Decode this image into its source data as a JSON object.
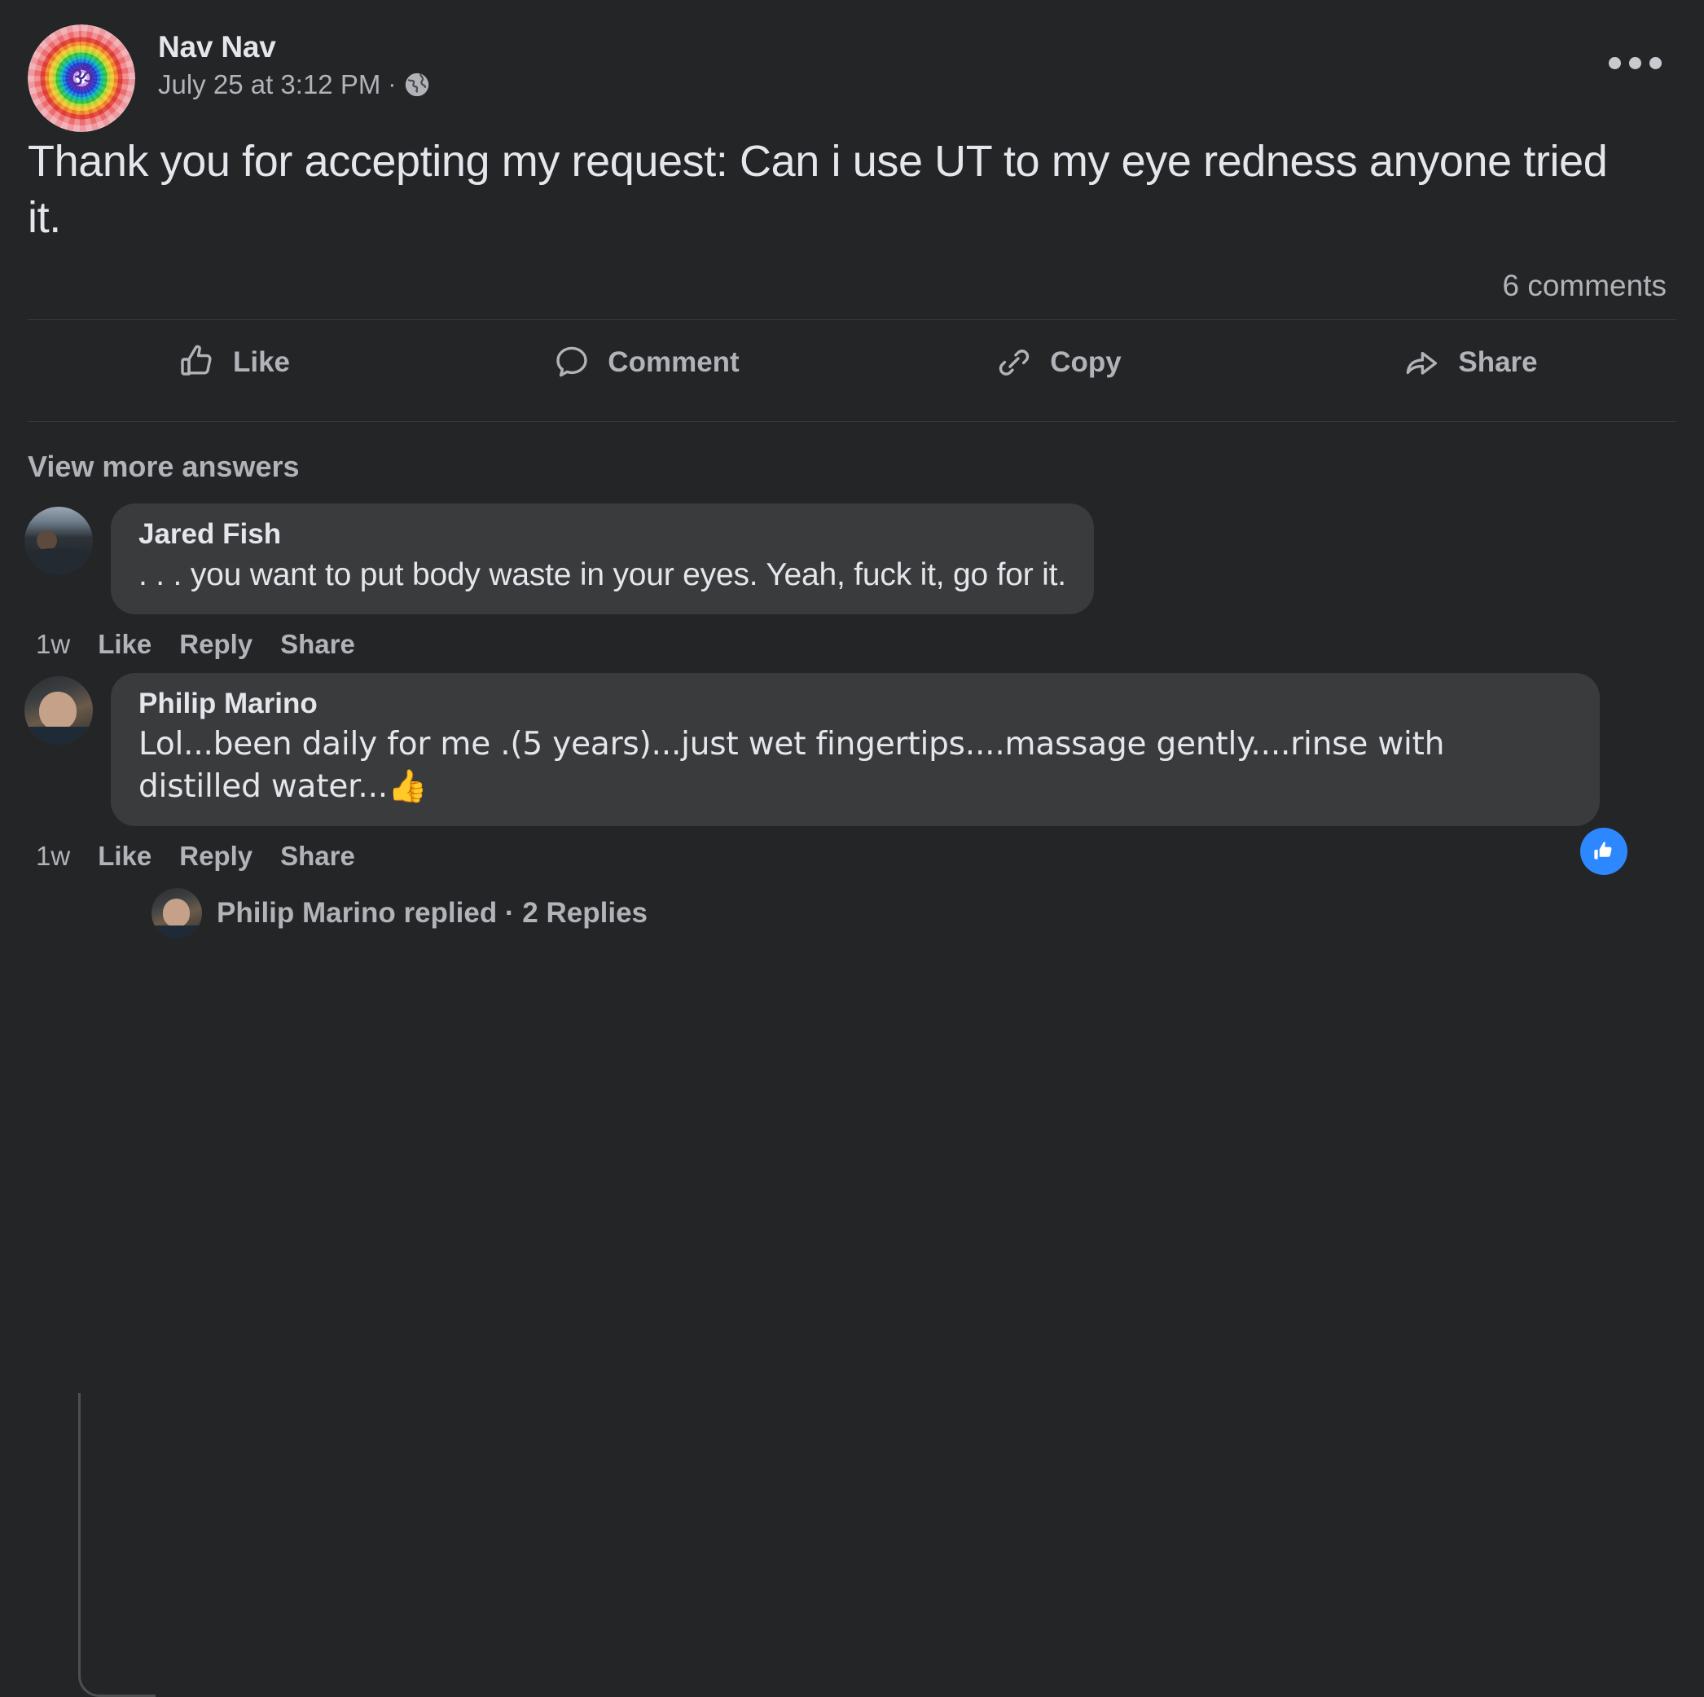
{
  "post": {
    "author": "Nav Nav",
    "timestamp": "July 25 at 3:12 PM",
    "separator": "·",
    "privacy_icon": "globe-icon",
    "menu_icon": "more-options-icon",
    "text": "Thank you for accepting my request: Can i use UT to my eye redness anyone tried it.",
    "comments_count": "6 comments"
  },
  "actions": [
    {
      "label": "Like",
      "icon": "thumbs-up-icon"
    },
    {
      "label": "Comment",
      "icon": "speech-bubble-icon"
    },
    {
      "label": "Copy",
      "icon": "link-icon"
    },
    {
      "label": "Share",
      "icon": "share-arrow-icon"
    }
  ],
  "comments_section": {
    "view_more_label": "View more answers",
    "comments": [
      {
        "author": "Jared Fish",
        "text": ". . . you want to put body waste in your eyes. Yeah, fuck it, go for it.",
        "time": "1w",
        "like_label": "Like",
        "reply_label": "Reply",
        "share_label": "Share",
        "has_like_badge": false
      },
      {
        "author": "Philip Marino",
        "text": "Lol...been daily for me .(5 years)...just wet fingertips....massage gently....rinse with distilled water...👍",
        "time": "1w",
        "like_label": "Like",
        "reply_label": "Reply",
        "share_label": "Share",
        "has_like_badge": true
      }
    ],
    "replied_row": {
      "text": "Philip Marino replied · 2 Replies"
    }
  },
  "colors": {
    "background": "#242526",
    "bubble": "#3a3b3c",
    "primary_text": "#e4e6eb",
    "secondary_text": "#b0b3b8",
    "accent_blue": "#2d88ff",
    "divider": "#3a3b3c"
  }
}
